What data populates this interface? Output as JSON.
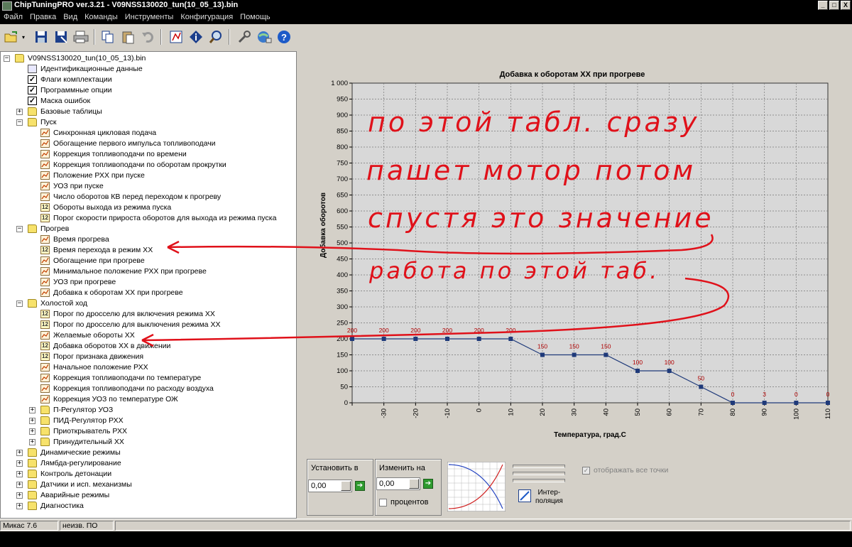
{
  "window": {
    "title": "ChipTuningPRO ver.3.21 - V09NSS130020_tun(10_05_13).bin",
    "minimize": "_",
    "maximize": "□",
    "close": "X"
  },
  "menu": [
    "Файл",
    "Правка",
    "Вид",
    "Команды",
    "Инструменты",
    "Конфигурация",
    "Помощь"
  ],
  "toolbar": {
    "icons": [
      "open-icon",
      "save-icon",
      "save-as-icon",
      "print-icon",
      "copy-icon",
      "paste-icon",
      "undo-icon",
      "compare-icon",
      "info-icon",
      "zoom-icon",
      "tools-icon",
      "network-icon",
      "help-icon"
    ]
  },
  "tree": {
    "root": "V09NSS130020_tun(10_05_13).bin",
    "items": [
      {
        "label": "Идентификационные данные",
        "icon": "id"
      },
      {
        "label": "Флаги комплектации",
        "icon": "check"
      },
      {
        "label": "Программные опции",
        "icon": "check"
      },
      {
        "label": "Маска ошибок",
        "icon": "check"
      },
      {
        "label": "Базовые таблицы",
        "icon": "folder"
      },
      {
        "label": "Пуск",
        "icon": "folder"
      },
      {
        "label": "Синхронная цикловая подача",
        "icon": "table"
      },
      {
        "label": "Обогащение первого импульса топливоподачи",
        "icon": "table"
      },
      {
        "label": "Коррекция топливоподачи по времени",
        "icon": "table"
      },
      {
        "label": "Коррекция топливоподачи по оборотам прокрутки",
        "icon": "table"
      },
      {
        "label": "Положение РХХ при пуске",
        "icon": "table"
      },
      {
        "label": "УОЗ при пуске",
        "icon": "table"
      },
      {
        "label": "Число оборотов КВ перед переходом к прогреву",
        "icon": "table"
      },
      {
        "label": "Обороты выхода из режима пуска",
        "icon": "num"
      },
      {
        "label": "Порог скорости прироста оборотов для выхода из режима пуска",
        "icon": "num"
      },
      {
        "label": "Прогрев",
        "icon": "folder"
      },
      {
        "label": "Время прогрева",
        "icon": "table"
      },
      {
        "label": "Время перехода в режим ХХ",
        "icon": "num"
      },
      {
        "label": "Обогащение при прогреве",
        "icon": "table"
      },
      {
        "label": "Минимальное положение РХХ при прогреве",
        "icon": "table"
      },
      {
        "label": "УОЗ при прогреве",
        "icon": "table"
      },
      {
        "label": "Добавка к оборотам ХХ при прогреве",
        "icon": "table"
      },
      {
        "label": "Холостой ход",
        "icon": "folder"
      },
      {
        "label": "Порог по дросселю для включения режима ХХ",
        "icon": "num"
      },
      {
        "label": "Порог по дросселю для выключения режима ХХ",
        "icon": "num"
      },
      {
        "label": "Желаемые обороты ХХ",
        "icon": "table"
      },
      {
        "label": "Добавка оборотов ХХ в движении",
        "icon": "num"
      },
      {
        "label": "Порог признака движения",
        "icon": "num"
      },
      {
        "label": "Начальное положение РХХ",
        "icon": "table"
      },
      {
        "label": "Коррекция топливоподачи по температуре",
        "icon": "table"
      },
      {
        "label": "Коррекция топливоподачи по расходу воздуха",
        "icon": "table"
      },
      {
        "label": "Коррекция УОЗ по температуре ОЖ",
        "icon": "table"
      },
      {
        "label": "П-Регулятор УОЗ",
        "icon": "folder"
      },
      {
        "label": "ПИД-Регулятор РХХ",
        "icon": "folder"
      },
      {
        "label": "Приоткрыватель РХХ",
        "icon": "folder"
      },
      {
        "label": "Принудительный ХХ",
        "icon": "folder"
      },
      {
        "label": "Динамические режимы",
        "icon": "folder"
      },
      {
        "label": "Лямбда-регулирование",
        "icon": "folder"
      },
      {
        "label": "Контроль детонации",
        "icon": "folder"
      },
      {
        "label": "Датчики и исп. механизмы",
        "icon": "folder"
      },
      {
        "label": "Аварийные режимы",
        "icon": "folder"
      },
      {
        "label": "Диагностика",
        "icon": "folder"
      }
    ]
  },
  "chart_data": {
    "type": "line",
    "title": "Добавка к оборотам ХХ при прогреве",
    "xlabel": "Температура, град.С",
    "ylabel": "Добавка оборотов",
    "x": [
      -40,
      -30,
      -20,
      -10,
      0,
      10,
      20,
      30,
      40,
      50,
      60,
      70,
      80,
      90,
      100,
      110
    ],
    "x_tick_labels": [
      "-30",
      "-20",
      "-10",
      "0",
      "10",
      "20",
      "30",
      "40",
      "50",
      "60",
      "70",
      "80",
      "90",
      "100",
      "110"
    ],
    "values": [
      200,
      200,
      200,
      200,
      200,
      200,
      150,
      150,
      150,
      100,
      100,
      50,
      0,
      0,
      0,
      0
    ],
    "data_labels": [
      "200",
      "200",
      "200",
      "200",
      "200",
      "200",
      "150",
      "150",
      "150",
      "100",
      "100",
      "50",
      "0",
      "3",
      "0",
      "0"
    ],
    "y_tick_labels": [
      "0",
      "50",
      "100",
      "150",
      "200",
      "250",
      "300",
      "350",
      "400",
      "450",
      "500",
      "550",
      "600",
      "650",
      "700",
      "750",
      "800",
      "850",
      "900",
      "950",
      "1 000"
    ],
    "ylim": [
      0,
      1000
    ],
    "xlim": [
      -40,
      110
    ],
    "grid": true,
    "line_color": "#1f3a7a",
    "marker_color": "#1f3a7a",
    "label_color": "#b00000"
  },
  "annotations": {
    "line1": "по этой табл. сразу",
    "line2": "пашет мотор потом",
    "line3": "спустя это значение",
    "line4": "работа по этой таб.",
    "color": "#e0111a"
  },
  "controls": {
    "set_label": "Установить в",
    "set_value": "0,00",
    "change_label": "Изменить на",
    "change_value": "0,00",
    "percent_label": "процентов",
    "interp_label_1": "Интер-",
    "interp_label_2": "поляция",
    "show_points_label": "отображать все точки"
  },
  "status": {
    "cell1": "Микас 7.6",
    "cell2": "неизв. ПО"
  }
}
